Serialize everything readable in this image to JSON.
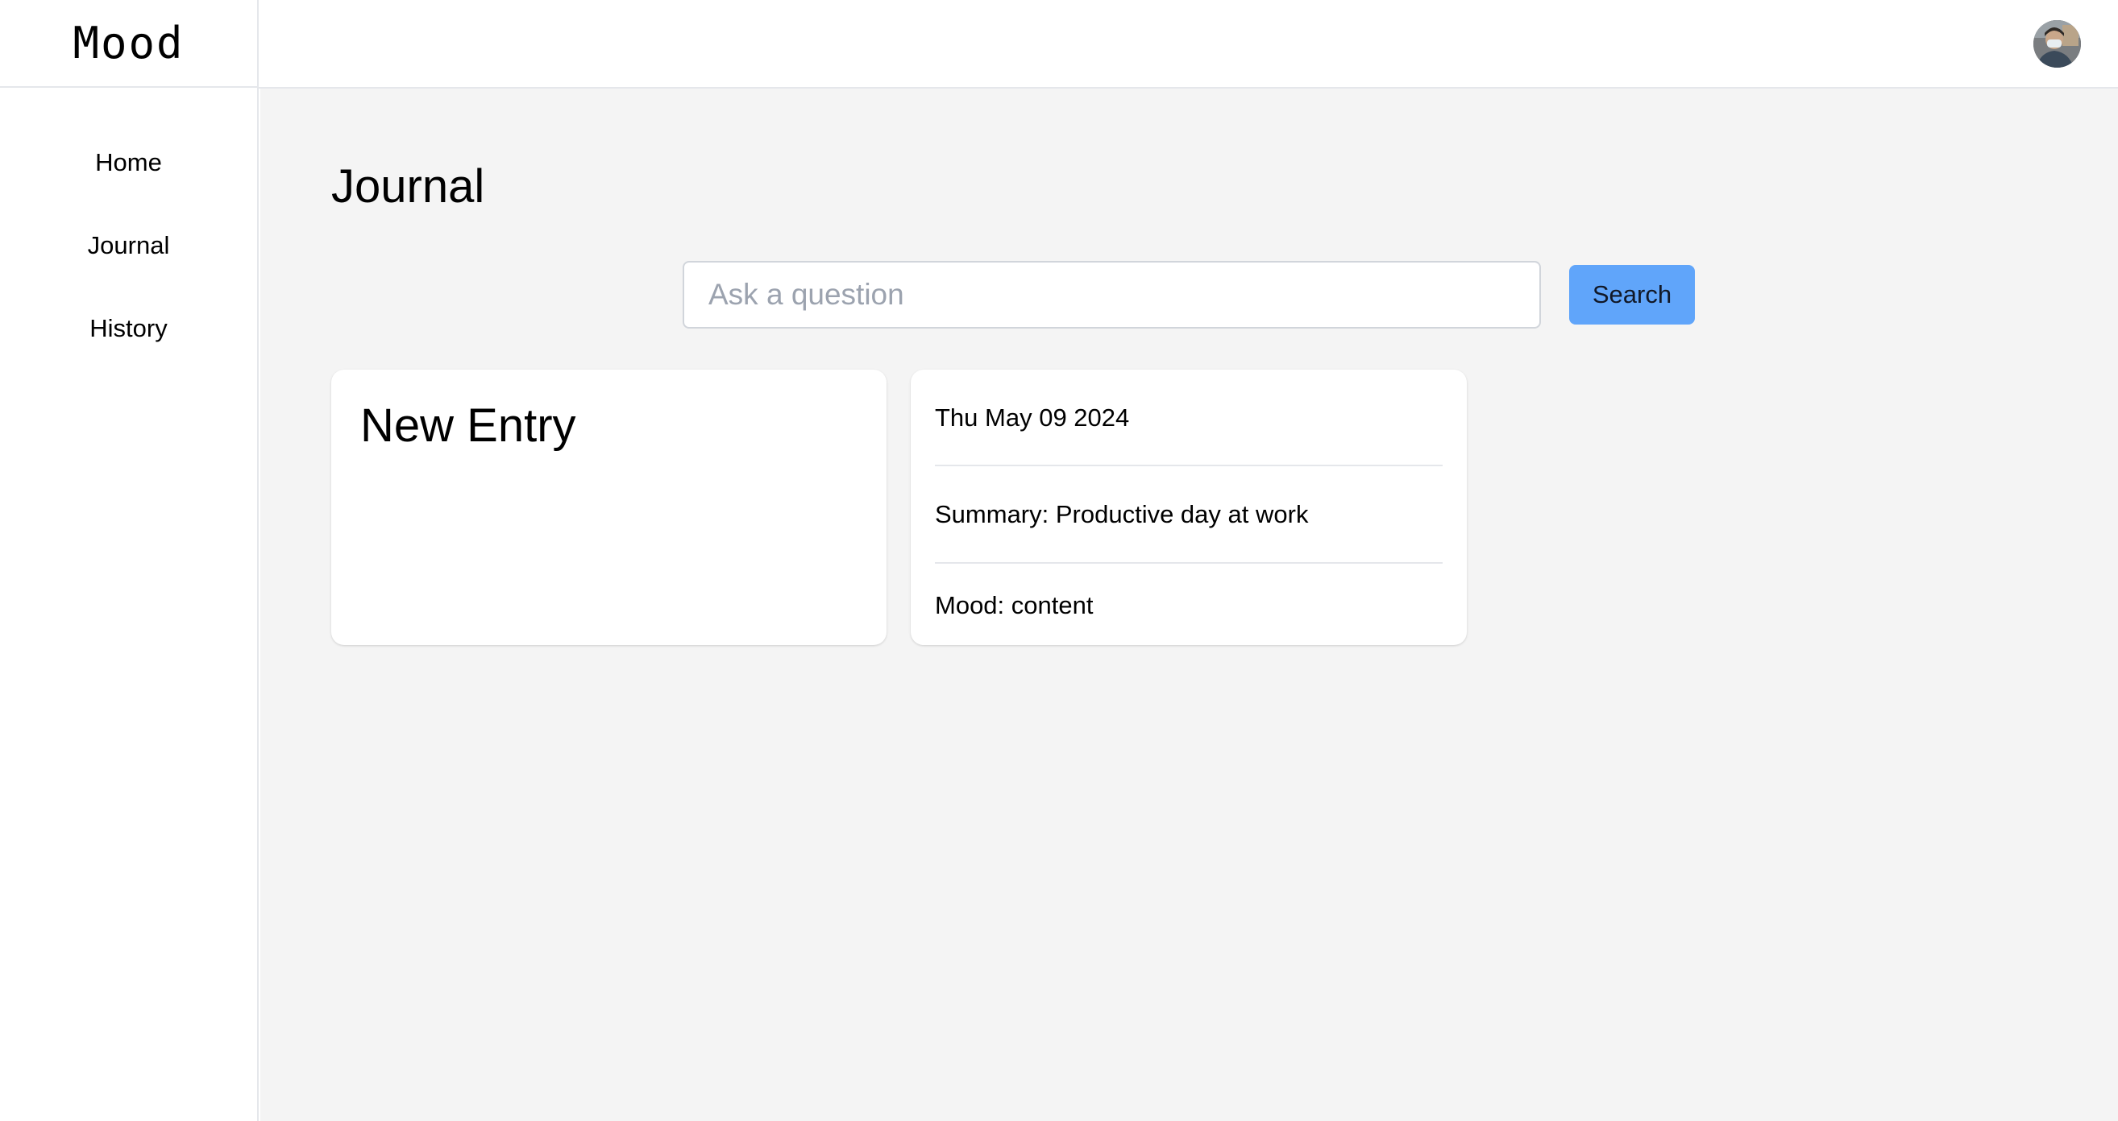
{
  "app": {
    "logo": "Mood"
  },
  "sidebar": {
    "items": [
      {
        "label": "Home"
      },
      {
        "label": "Journal"
      },
      {
        "label": "History"
      }
    ]
  },
  "page": {
    "title": "Journal"
  },
  "search": {
    "placeholder": "Ask a question",
    "value": "",
    "button_label": "Search"
  },
  "cards": {
    "new_entry": {
      "label": "New Entry"
    },
    "entries": [
      {
        "date": "Thu May 09 2024",
        "summary": "Summary: Productive day at work",
        "mood": "Mood: content"
      }
    ]
  },
  "colors": {
    "accent": "#60a5fa",
    "main_background": "#f4f4f4",
    "border": "#e5e7eb"
  },
  "icons": {
    "avatar": "user-avatar"
  }
}
